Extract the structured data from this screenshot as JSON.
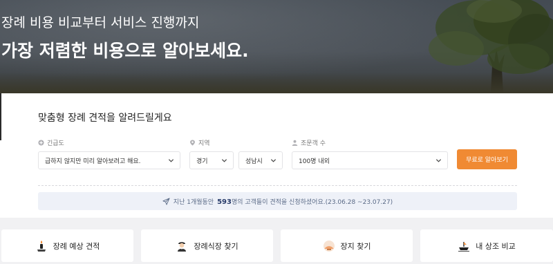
{
  "hero": {
    "line1": "장례 비용 비교부터 서비스 진행까지",
    "line2": "가장 저렴한 비용으로 알아보세요."
  },
  "estimate": {
    "title": "맞춤형 장례 견적을 알려드릴게요",
    "urgency": {
      "label": "긴급도",
      "value": "급하지 않지만 미리 알아보려고 해요."
    },
    "region": {
      "label": "지역",
      "province": "경기",
      "city": "성남시"
    },
    "guests": {
      "label": "조문객 수",
      "value": "100명 내외"
    },
    "cta_label": "무료로 알아보기",
    "notice": {
      "prefix": "지난 1개월동안",
      "count": "593",
      "suffix": "명의 고객들이 견적을 신청하셨어요.",
      "period": "(23.06.28 ~23.07.27)"
    }
  },
  "bottom_nav": [
    {
      "label": "장례 예상 견적",
      "icon": "candle-icon"
    },
    {
      "label": "장례식장 찾기",
      "icon": "person-search-icon"
    },
    {
      "label": "장지 찾기",
      "icon": "hill-icon"
    },
    {
      "label": "내 상조 비교",
      "icon": "ship-icon"
    }
  ],
  "colors": {
    "accent": "#f08a33",
    "notice_bg": "#eef1f8",
    "notice_text": "#5a6a86"
  }
}
